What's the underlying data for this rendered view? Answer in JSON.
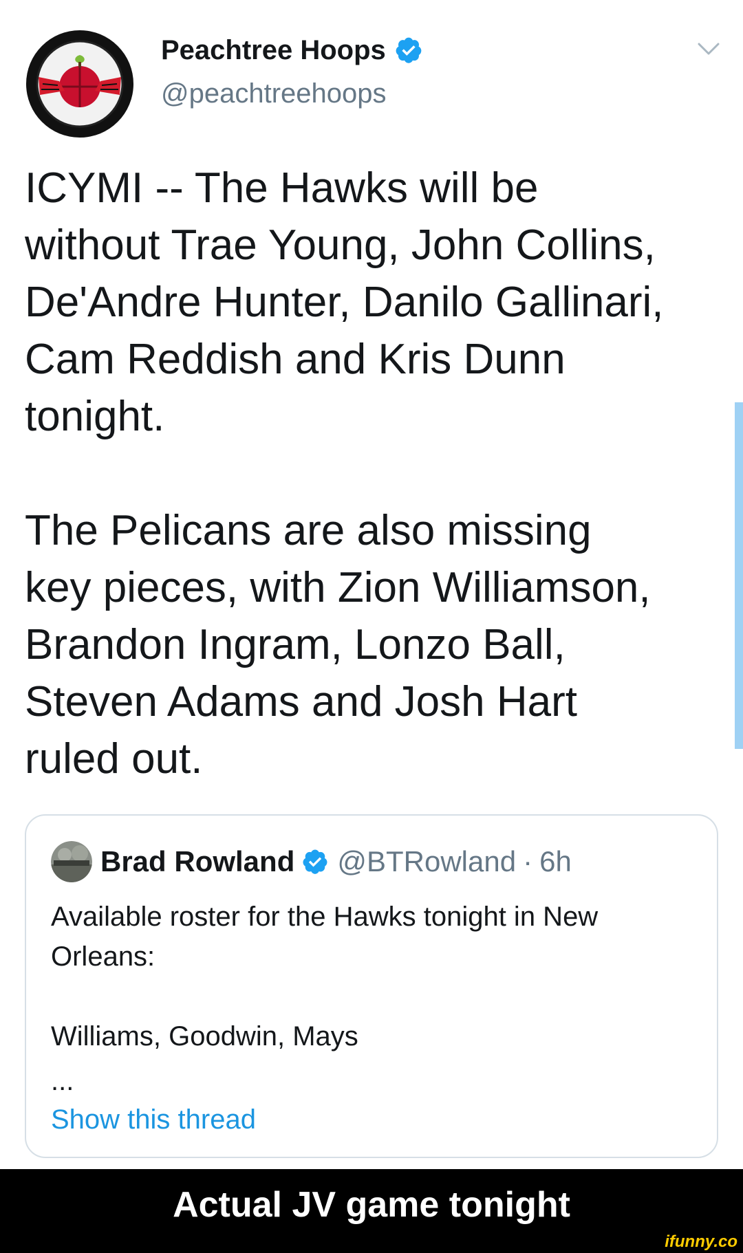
{
  "tweet": {
    "author": {
      "display_name": "Peachtree Hoops",
      "handle": "@peachtreehoops",
      "avatar_icon": "peachtree-hoops-logo-icon",
      "verified_icon": "verified-badge-icon"
    },
    "menu_icon": "chevron-down-icon",
    "text": "ICYMI -- The Hawks will be\nwithout Trae Young, John Collins,\nDe'Andre Hunter, Danilo Gallinari,\nCam Reddish and Kris Dunn\ntonight.\n\nThe Pelicans are also missing\nkey pieces, with Zion Williamson,\nBrandon Ingram, Lonzo Ball,\nSteven Adams and Josh Hart\nruled out."
  },
  "quoted_tweet": {
    "display_name": "Brad Rowland",
    "handle": "@BTRowland",
    "separator": "·",
    "time": "6h",
    "text": "Available roster for the Hawks tonight in New\nOrleans:\n\nWilliams, Goodwin, Mays",
    "ellipsis": "...",
    "show_thread": "Show this thread"
  },
  "caption": "Actual JV game tonight",
  "watermark": "ifunny.co",
  "colors": {
    "link": "#1b95e0",
    "secondary_text": "#657786",
    "verified": "#1da1f2",
    "scrollbar": "#9fd1f4"
  }
}
